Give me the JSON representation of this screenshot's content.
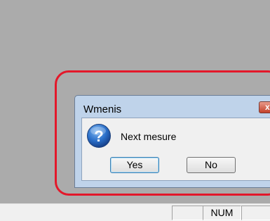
{
  "dialog": {
    "title": "Wmenis",
    "close_glyph": "x",
    "icon": "question-icon",
    "message": "Next mesure",
    "buttons": {
      "yes": "Yes",
      "no": "No"
    }
  },
  "statusbar": {
    "num": "NUM"
  },
  "colors": {
    "background": "#ababab",
    "highlight_outline": "#e3182a",
    "dialog_frame": "#bfd3ea",
    "icon_blue": "#2a6fc9"
  }
}
